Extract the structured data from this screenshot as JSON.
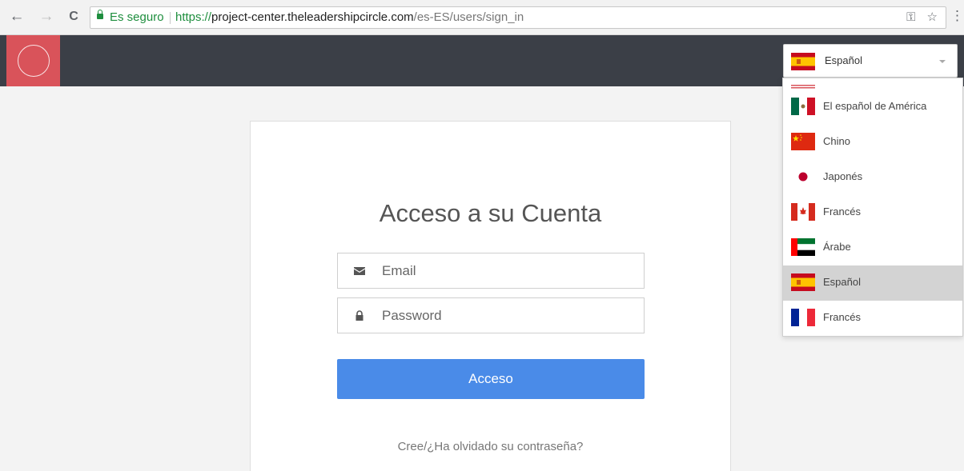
{
  "browser": {
    "secure_label": "Es seguro",
    "url_scheme": "https://",
    "url_host": "project-center.theleadershipcircle.com",
    "url_path": "/es-ES/users/sign_in",
    "back_icon": "←",
    "forward_icon": "→",
    "reload_icon": "C",
    "key_icon": "⚿",
    "star_icon": "☆",
    "menu_icon": "⋮"
  },
  "header": {
    "brand_color": "#d9535a",
    "bar_color": "#3b3f47"
  },
  "language": {
    "selected": "Español",
    "options": [
      {
        "label": "El español de América",
        "flag": "mexico-flag"
      },
      {
        "label": "Chino",
        "flag": "china-flag"
      },
      {
        "label": "Japonés",
        "flag": "japan-flag"
      },
      {
        "label": "Francés",
        "flag": "canada-flag"
      },
      {
        "label": "Árabe",
        "flag": "uae-flag"
      },
      {
        "label": "Español",
        "flag": "spain-flag",
        "selected": true
      },
      {
        "label": "Francés",
        "flag": "france-flag"
      }
    ]
  },
  "login": {
    "title": "Acceso a su Cuenta",
    "email_placeholder": "Email",
    "password_placeholder": "Password",
    "submit_label": "Acceso",
    "forgot_link": "Cree/¿Ha olvidado su contraseña?",
    "accent_color": "#4a8be8"
  }
}
